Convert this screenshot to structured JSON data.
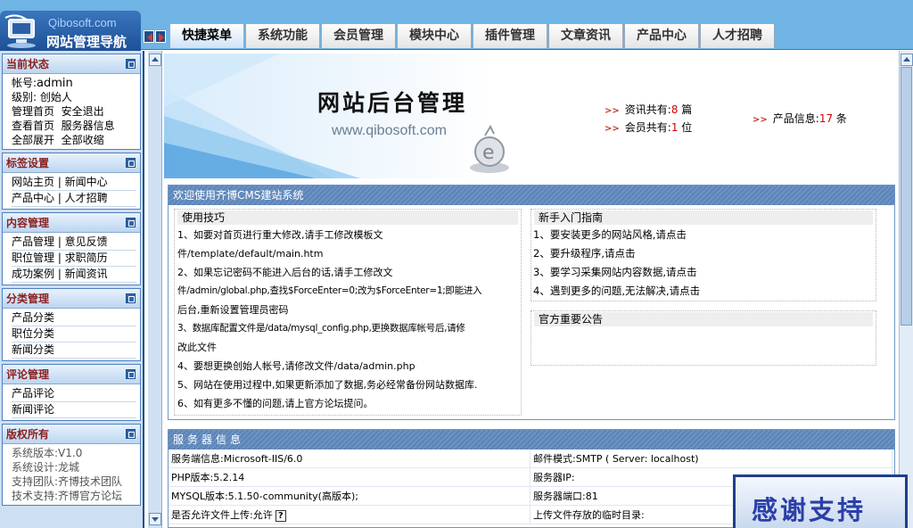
{
  "logo": {
    "sub": "Qibosoft.com",
    "main": "网站管理导航"
  },
  "tabs": [
    {
      "label": "快捷菜单",
      "active": true
    },
    {
      "label": "系统功能",
      "active": false
    },
    {
      "label": "会员管理",
      "active": false
    },
    {
      "label": "模块中心",
      "active": false
    },
    {
      "label": "插件管理",
      "active": false
    },
    {
      "label": "文章资讯",
      "active": false
    },
    {
      "label": "产品中心",
      "active": false
    },
    {
      "label": "人才招聘",
      "active": false
    }
  ],
  "sidebar": {
    "status": {
      "title": "当前状态",
      "account_label": "帐号:",
      "account_value": "admin",
      "level_label": "级别:",
      "level_value": "创始人",
      "links": [
        [
          "管理首页",
          "安全退出"
        ],
        [
          "查看首页",
          "服务器信息"
        ],
        [
          "全部展开",
          "全部收缩"
        ]
      ]
    },
    "tags": {
      "title": "标签设置",
      "rows": [
        "网站主页 | 新闻中心",
        "产品中心 | 人才招聘"
      ]
    },
    "content": {
      "title": "内容管理",
      "rows": [
        "产品管理 | 意见反馈",
        "职位管理 | 求职简历",
        "成功案例 | 新闻资讯"
      ]
    },
    "category": {
      "title": "分类管理",
      "rows": [
        "产品分类",
        "职位分类",
        "新闻分类"
      ]
    },
    "comments": {
      "title": "评论管理",
      "rows": [
        "产品评论",
        "新闻评论"
      ]
    },
    "copyright": {
      "title": "版权所有",
      "rows": [
        "系统版本:V1.0",
        "系统设计:龙城",
        "支持团队:齐博技术团队",
        "技术支持:齐博官方论坛"
      ]
    }
  },
  "banner": {
    "title": "网站后台管理",
    "url": "www.qibosoft.com",
    "stats": {
      "articles": {
        "label": "资讯共有:",
        "value": "8",
        "unit": "篇"
      },
      "members": {
        "label": "会员共有:",
        "value": "1",
        "unit": "位"
      },
      "products": {
        "label": "产品信息:",
        "value": "17",
        "unit": "条"
      }
    }
  },
  "welcome": {
    "title": "欢迎使用齐博CMS建站系统",
    "tips_title": "使用技巧",
    "tips": [
      "1、如要对首页进行重大修改,请手工修改模板文",
      "件/template/default/main.htm",
      "2、如果忘记密码不能进入后台的话,请手工修改文",
      "件/admin/global.php,查找$ForceEnter=0;改为$ForceEnter=1;即能进入",
      "后台,重新设置管理员密码",
      "3、数据库配置文件是/data/mysql_config.php,更换数据库帐号后,请修",
      "改此文件",
      "4、要想更换创始人帐号,请修改文件/data/admin.php",
      "5、网站在使用过程中,如果更新添加了数据,务必经常备份网站数据库.",
      "6、如有更多不懂的问题,请上官方论坛提问。"
    ],
    "guide_title": "新手入门指南",
    "guide": [
      "1、要安装更多的网站风格,请点击",
      "2、要升级程序,请点击",
      "3、要学习采集网站内容数据,请点击",
      "4、遇到更多的问题,无法解决,请点击"
    ],
    "notice_title": "官方重要公告"
  },
  "server": {
    "title": "服务器信息",
    "rows": [
      [
        "服务端信息:Microsoft-IIS/6.0",
        "邮件模式:SMTP ( Server: localhost)"
      ],
      [
        "PHP版本:5.2.14",
        "服务器IP:"
      ],
      [
        "MYSQL版本:5.1.50-community(高版本);",
        "服务器端口:81"
      ],
      [
        "是否允许文件上传:允许",
        "上传文件存放的临时目录:"
      ]
    ],
    "help_glyph": "?"
  },
  "thanks": "感谢支持"
}
